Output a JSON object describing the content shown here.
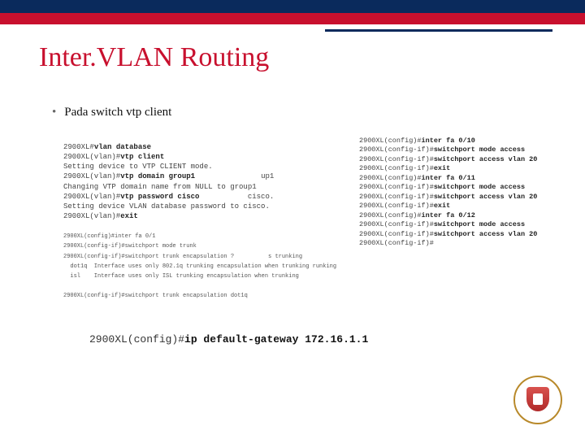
{
  "slide": {
    "title": "Inter.VLAN Routing",
    "bullet": "Pada switch vtp client"
  },
  "cli_left": {
    "l1p": "2900XL#",
    "l1c": "vlan database",
    "l2p": "2900XL(vlan)#",
    "l2c": "vtp client",
    "l3": "Setting device to VTP CLIENT mode.",
    "l4p": "2900XL(vlan)#",
    "l4c": "vtp domain group1",
    "l4r": "up1",
    "l5": "Changing VTP domain name from NULL to group1",
    "l6p": "2900XL(vlan)#",
    "l6c": "vtp password cisco",
    "l6r": "cisco.",
    "l7": "Setting device VLAN database password to cisco.",
    "l8p": "2900XL(vlan)#",
    "l8c": "exit",
    "t1": "2900XL(config)#inter fa 0/1",
    "t2": "2900XL(config-if)#switchport mode trunk",
    "t3": "2900XL(config-if)#switchport trunk encapsulation ?          s trunking",
    "t4": "  dot1q  Interface uses only 802.1q trunking encapsulation when trunking runking",
    "t5": "  isl    Interface uses only ISL trunking encapsulation when trunking",
    "t6": "2900XL(config-if)#switchport trunk encapsulation dot1q"
  },
  "cli_right": {
    "r1p": "2900XL(config)#",
    "r1c": "inter fa 0/10",
    "r2p": "2900XL(config-if)#",
    "r2c": "switchport mode access",
    "r3p": "2900XL(config-if)#",
    "r3c": "switchport access vlan 20",
    "r4p": "2900XL(config-if)#",
    "r4c": "exit",
    "r5p": "2900XL(config)#",
    "r5c": "inter fa 0/11",
    "r6p": "2900XL(config-if)#",
    "r6c": "switchport mode access",
    "r7p": "2900XL(config-if)#",
    "r7c": "switchport access vlan 20",
    "r8p": "2900XL(config-if)#",
    "r8c": "exit",
    "r9p": "2900XL(config)#",
    "r9c": "inter fa 0/12",
    "r10p": "2900XL(config-if)#",
    "r10c": "switchport mode access",
    "r11p": "2900XL(config-if)#",
    "r11c": "switchport access vlan 20",
    "r12p": "2900XL(config-if)#"
  },
  "cli_bottom": {
    "prompt": "2900XL(config)#",
    "cmd": "ip default-gateway 172.16.1.1"
  },
  "logo": {
    "alt": "university-seal"
  }
}
